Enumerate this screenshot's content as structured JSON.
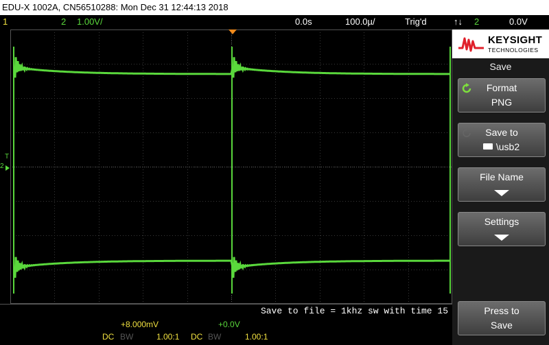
{
  "titlebar": {
    "text": "EDU-X 1002A, CN56510288: Mon Dec 31 12:44:13 2018"
  },
  "status": {
    "ch1_label": "1",
    "ch2_label": "2",
    "ch2_scale": "1.00V/",
    "time_offset": "0.0s",
    "time_scale": "100.0µ/",
    "trigger_state": "Trig'd",
    "trigger_slope": "↑↓",
    "trigger_source": "2",
    "trigger_level": "0.0V"
  },
  "markers": {
    "trigger_marker": "T",
    "ch2_ground": "2"
  },
  "save_message": "Save to file = 1khz sw with time 15",
  "bottom": {
    "ch1_offset": "+8.000mV",
    "ch2_offset": "+0.0V",
    "ch1_coupling": "DC",
    "ch1_bw": "BW",
    "ch1_probe": "1.00:1",
    "ch2_coupling": "DC",
    "ch2_bw": "BW",
    "ch2_probe": "1.00:1"
  },
  "panel": {
    "brand": "KEYSIGHT",
    "brand_sub": "TECHNOLOGIES",
    "menu_title": "Save",
    "softkeys": [
      {
        "line1": "Format",
        "line2": "PNG"
      },
      {
        "line1": "Save to",
        "line2": "\\usb2"
      },
      {
        "line1": "File Name"
      },
      {
        "line1": "Settings"
      },
      {
        "line1": "Press to",
        "line2": "Save"
      }
    ]
  },
  "colors": {
    "ch1": "#f0e040",
    "ch2": "#5ad83c",
    "trigger_marker": "#f08a1c"
  }
}
